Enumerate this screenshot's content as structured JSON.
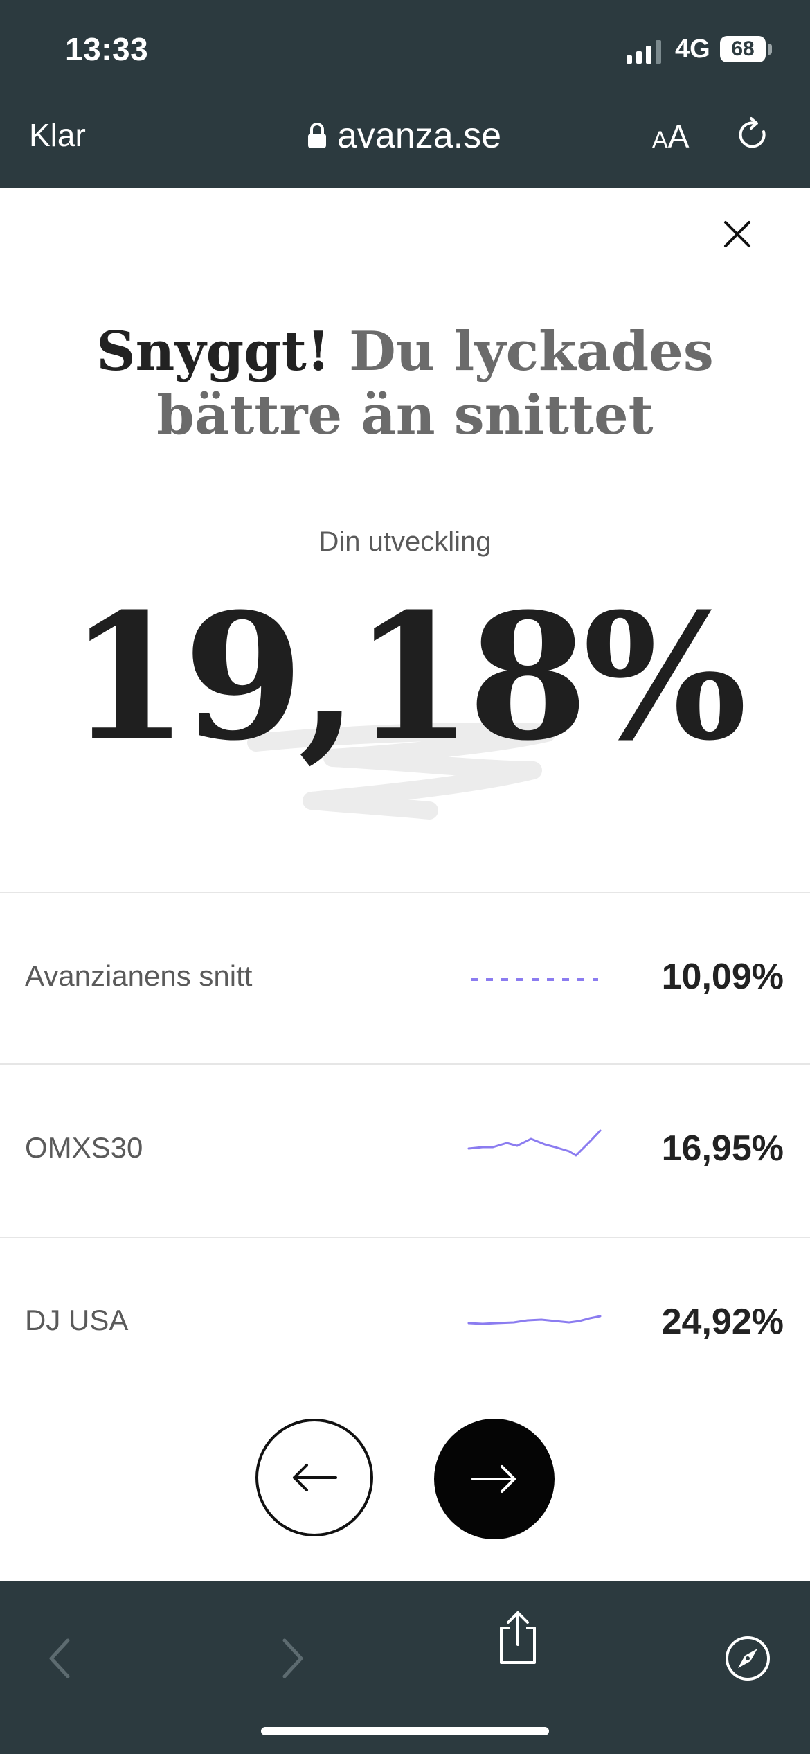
{
  "status_bar": {
    "time": "13:33",
    "network": "4G",
    "battery": "68"
  },
  "browser": {
    "done_label": "Klar",
    "url": "avanza.se",
    "text_size_small": "A",
    "text_size_large": "A"
  },
  "result": {
    "headline_strong": "Snyggt!",
    "headline_rest": "Du lyckades bättre än snittet",
    "subtitle": "Din utveckling",
    "value": "19,18%"
  },
  "comparisons": [
    {
      "label": "Avanzianens snitt",
      "value": "10,09%",
      "line_style": "dashed"
    },
    {
      "label": "OMXS30",
      "value": "16,95%",
      "line_style": "sparkline"
    },
    {
      "label": "DJ USA",
      "value": "24,92%",
      "line_style": "sparkline"
    }
  ],
  "icons": {
    "lock": "lock-icon",
    "reload": "reload-icon",
    "close": "close-icon",
    "prev": "arrow-left-icon",
    "next": "arrow-right-icon",
    "back": "chevron-left-icon",
    "forward": "chevron-right-icon",
    "share": "share-icon",
    "compass": "compass-icon"
  },
  "colors": {
    "chrome": "#2c3a3f",
    "accent_line": "#8b7cf0",
    "headline_grey": "#6b6b6b"
  }
}
